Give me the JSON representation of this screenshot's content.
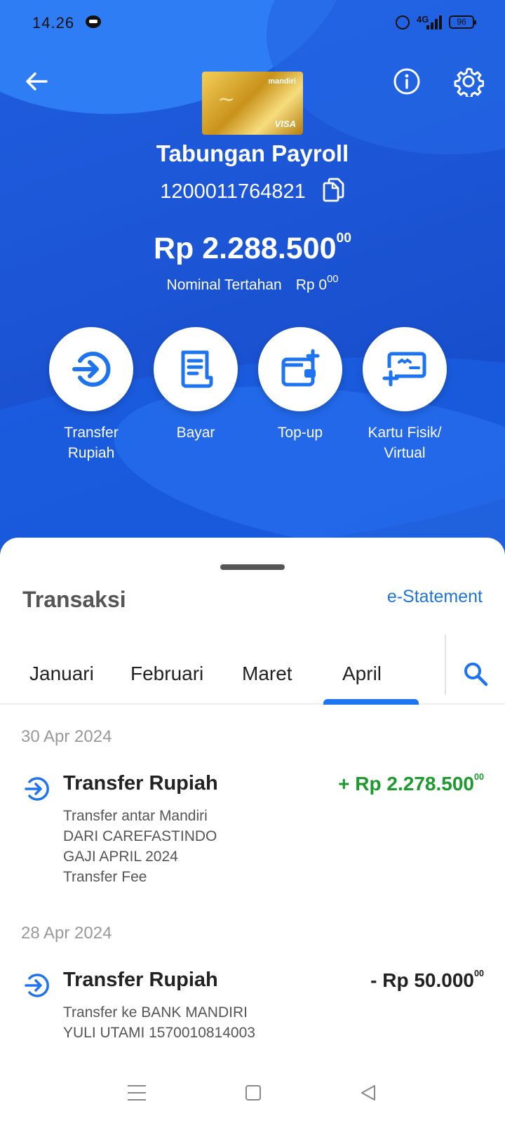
{
  "status_bar": {
    "time": "14.26",
    "network": "4G",
    "battery": "96"
  },
  "header": {
    "account_name": "Tabungan Payroll",
    "account_number": "1200011764821",
    "balance": "Rp 2.288.500",
    "balance_cents": "00",
    "held_label": "Nominal Tertahan",
    "held_amount": "Rp 0",
    "held_cents": "00"
  },
  "card": {
    "brand": "mandiri",
    "network": "VISA"
  },
  "actions": [
    {
      "label_line1": "Transfer",
      "label_line2": "Rupiah",
      "icon": "transfer-icon"
    },
    {
      "label_line1": "Bayar",
      "label_line2": "",
      "icon": "bill-icon"
    },
    {
      "label_line1": "Top-up",
      "label_line2": "",
      "icon": "wallet-add-icon"
    },
    {
      "label_line1": "Kartu Fisik/",
      "label_line2": "Virtual",
      "icon": "card-add-icon"
    }
  ],
  "transactions_section": {
    "title": "Transaksi",
    "estatement_label": "e-Statement",
    "tabs": [
      "Januari",
      "Februari",
      "Maret",
      "April"
    ],
    "active_tab": "April"
  },
  "transactions": [
    {
      "date": "30 Apr 2024",
      "title": "Transfer Rupiah",
      "amount": "+ Rp 2.278.500",
      "cents": "00",
      "type": "credit",
      "desc": [
        "Transfer antar Mandiri",
        "DARI CAREFASTINDO",
        "GAJI APRIL 2024",
        "Transfer Fee"
      ]
    },
    {
      "date": "28 Apr 2024",
      "title": "Transfer Rupiah",
      "amount": "- Rp 50.000",
      "cents": "00",
      "type": "debit",
      "desc": [
        "Transfer ke BANK MANDIRI",
        "YULI UTAMI 1570010814003"
      ]
    }
  ],
  "colors": {
    "primary": "#1c56d6",
    "accent": "#1e74f0",
    "credit": "#1c9a2e"
  }
}
